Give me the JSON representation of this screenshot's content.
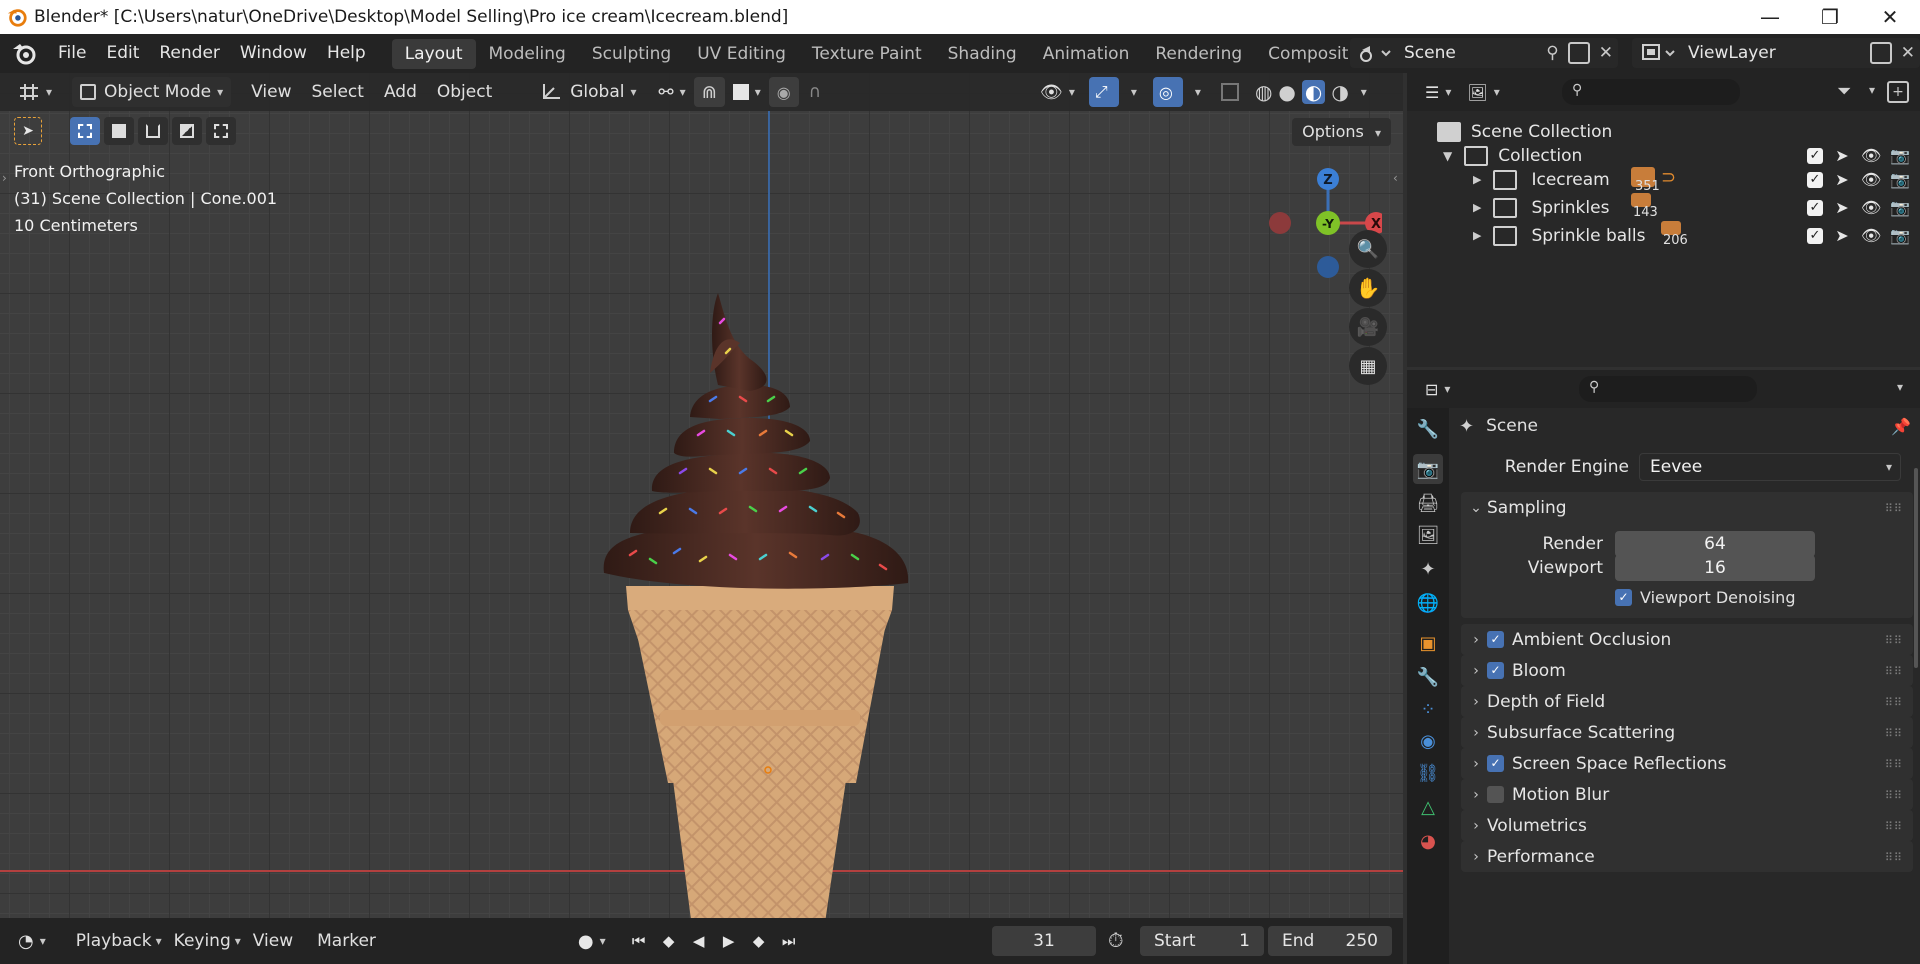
{
  "window": {
    "title": "Blender* [C:\\Users\\natur\\OneDrive\\Desktop\\Model Selling\\Pro ice cream\\Icecream.blend]",
    "min_glyph": "—",
    "max_glyph": "❐",
    "close_glyph": "✕"
  },
  "menu": [
    "File",
    "Edit",
    "Render",
    "Window",
    "Help"
  ],
  "workspaces": [
    "Layout",
    "Modeling",
    "Sculpting",
    "UV Editing",
    "Texture Paint",
    "Shading",
    "Animation",
    "Rendering",
    "Compositin"
  ],
  "scene_selector": {
    "label": "Scene"
  },
  "view_layer": {
    "label": "ViewLayer"
  },
  "viewport": {
    "mode": "Object Mode",
    "menus": [
      "View",
      "Select",
      "Add",
      "Object"
    ],
    "orientation": "Global",
    "options_label": "Options",
    "overlay": {
      "view_name": "Front Orthographic",
      "context": "(31) Scene Collection | Cone.001",
      "scale": "10 Centimeters"
    },
    "gizmo": {
      "z": "Z",
      "y": "-Y",
      "x": "X"
    }
  },
  "timeline": {
    "menus": [
      "Playback",
      "Keying",
      "View",
      "Marker"
    ],
    "current_frame": "31",
    "start_label": "Start",
    "start": "1",
    "end_label": "End",
    "end": "250"
  },
  "outliner": {
    "root": "Scene Collection",
    "collection": "Collection",
    "children": [
      {
        "name": "Icecream",
        "count": "351"
      },
      {
        "name": "Sprinkles",
        "count": "143"
      },
      {
        "name": "Sprinkle balls",
        "count": "206"
      }
    ]
  },
  "properties": {
    "context": "Scene",
    "render_engine_label": "Render Engine",
    "render_engine": "Eevee",
    "sampling": {
      "title": "Sampling",
      "render_label": "Render",
      "render": "64",
      "viewport_label": "Viewport",
      "viewport": "16",
      "denoise_label": "Viewport Denoising"
    },
    "panels": [
      {
        "title": "Ambient Occlusion",
        "checked": true
      },
      {
        "title": "Bloom",
        "checked": true
      },
      {
        "title": "Depth of Field",
        "checked": null
      },
      {
        "title": "Subsurface Scattering",
        "checked": null
      },
      {
        "title": "Screen Space Reflections",
        "checked": true
      },
      {
        "title": "Motion Blur",
        "checked": false
      },
      {
        "title": "Volumetrics",
        "checked": null
      },
      {
        "title": "Performance",
        "checked": null
      }
    ]
  },
  "colors": {
    "accent": "#4772b3",
    "x_axis": "#b3403f",
    "z_axis": "#3b6fb5",
    "cone": "#d6a878",
    "chocolate": "#4a2a22"
  }
}
